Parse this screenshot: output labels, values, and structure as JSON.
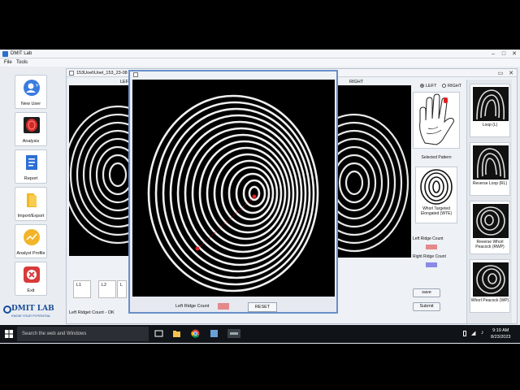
{
  "window": {
    "title": "DMIT Lab"
  },
  "menu": {
    "items": [
      "File",
      "Tools"
    ]
  },
  "sidebar": {
    "items": [
      {
        "label": "New User"
      },
      {
        "label": "Analysis"
      },
      {
        "label": "Report"
      },
      {
        "label": "Import/Export"
      },
      {
        "label": "Analyst Profile"
      },
      {
        "label": "Exit"
      }
    ],
    "logo": {
      "title": "DMIT LAB",
      "tagline": "KNOW YOUR POTENTIAL"
    }
  },
  "inner_window": {
    "title": "153Uoel\\Uoel_153_23-08",
    "left_label": "LEFT",
    "right_label": "RIGHT",
    "slots": [
      "L1",
      "L2",
      "L"
    ],
    "status": "Left Ridget Count - OK"
  },
  "hand_panel": {
    "radio_left": "LEFT",
    "radio_right": "RIGHT",
    "selected_pattern_label": "Selected Pattern",
    "selected_pattern": "Whorl Targeted Elongated (WTE)",
    "left_ridge_count_label": "Left Ridge Count",
    "right_ridge_count_label": "Right Ridge Count",
    "save": "save",
    "submit": "Submit",
    "left_color": "#e48a8a",
    "right_color": "#8a8ae4"
  },
  "pattern_list": [
    {
      "label": "Loop (L)"
    },
    {
      "label": "Reverse Loop (RL)"
    },
    {
      "label": "Reverse Whorl Peacock (RWP)"
    },
    {
      "label": "Whorl Peacock (WP)"
    }
  ],
  "popup": {
    "left_ridge_count_label": "Left Ridge Count",
    "reset": "RESET"
  },
  "taskbar": {
    "search_placeholder": "Search the web and Windows",
    "time": "9:19 AM",
    "date": "8/23/2023"
  }
}
